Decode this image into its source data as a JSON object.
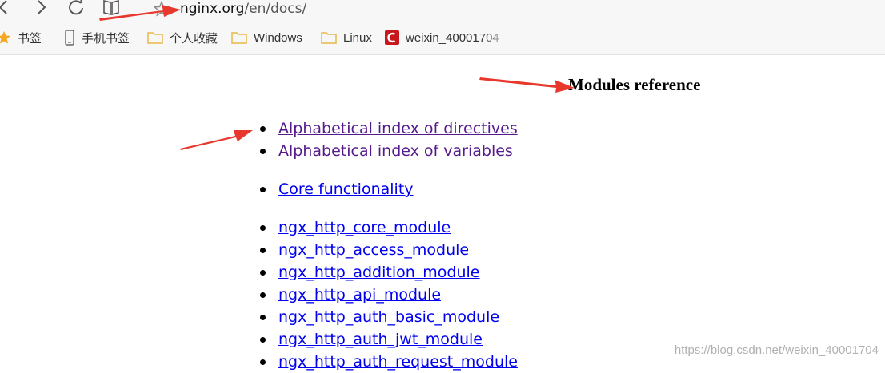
{
  "browser": {
    "url_domain": "nginx.org",
    "url_path": "/en/docs/",
    "bookmarks": [
      {
        "label": "书签",
        "icon": "star-icon"
      },
      {
        "label": "手机书签",
        "icon": "phone-icon"
      },
      {
        "label": "个人收藏",
        "icon": "folder-icon"
      },
      {
        "label": "Windows",
        "icon": "folder-icon"
      },
      {
        "label": "Linux",
        "icon": "folder-icon"
      },
      {
        "label": "weixin_40001704",
        "icon": "csdn-icon"
      }
    ]
  },
  "page": {
    "title": "Modules reference",
    "groups": [
      [
        "Alphabetical index of directives",
        "Alphabetical index of variables"
      ],
      [
        "Core functionality"
      ],
      [
        "ngx_http_core_module",
        "ngx_http_access_module",
        "ngx_http_addition_module",
        "ngx_http_api_module",
        "ngx_http_auth_basic_module",
        "ngx_http_auth_jwt_module",
        "ngx_http_auth_request_module"
      ]
    ]
  },
  "watermark": "https://blog.csdn.net/weixin_40001704",
  "colors": {
    "link": "#0000ee",
    "visited_link": "#551a8b",
    "annotation_arrow": "#e8372c",
    "bookmark_star": "#f5a623",
    "folder": "#e8b84a",
    "csdn": "#c8161d"
  }
}
